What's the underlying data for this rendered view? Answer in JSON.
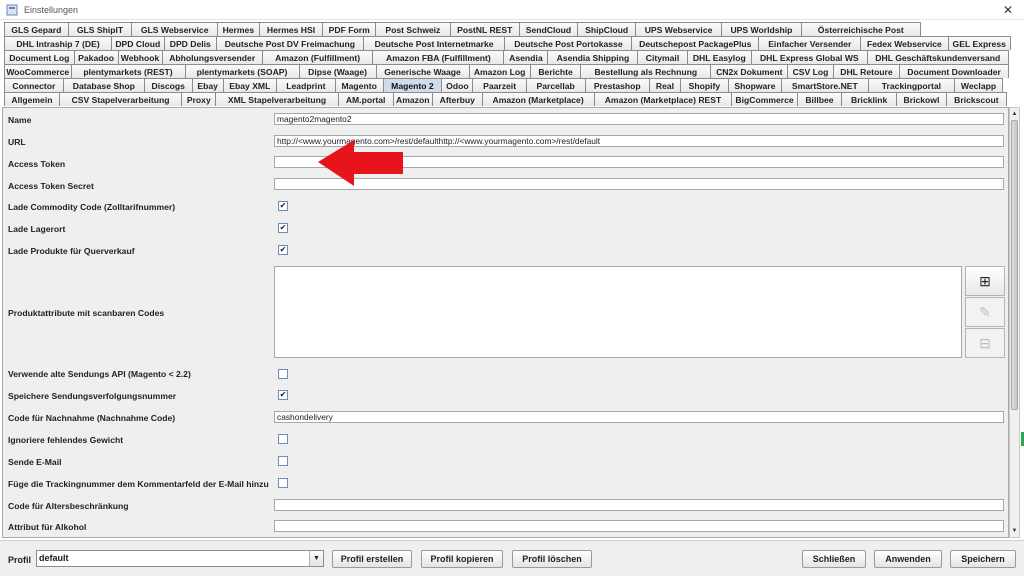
{
  "window": {
    "title": "Einstellungen",
    "close_glyph": "✕"
  },
  "tabs": {
    "row1": [
      "GLS Gepard",
      "GLS ShipIT",
      "GLS Webservice",
      "Hermes",
      "Hermes HSI",
      "PDF Form",
      "Post Schweiz",
      "PostNL REST",
      "SendCloud",
      "ShipCloud",
      "UPS Webservice",
      "UPS Worldship",
      "Österreichische Post"
    ],
    "row2": [
      "DHL Intraship 7 (DE)",
      "DPD Cloud",
      "DPD Delis",
      "Deutsche Post DV Freimachung",
      "Deutsche Post Internetmarke",
      "Deutsche Post Portokasse",
      "Deutschepost PackagePlus",
      "Einfacher Versender",
      "Fedex Webservice",
      "GEL Express"
    ],
    "row3": [
      "Document Log",
      "Pakadoo",
      "Webhook",
      "Abholungsversender",
      "Amazon (Fulfillment)",
      "Amazon FBA (Fulfillment)",
      "Asendia",
      "Asendia Shipping",
      "Citymail",
      "DHL Easylog",
      "DHL Express Global WS",
      "DHL Geschäftskundenversand"
    ],
    "row4": [
      "WooCommerce",
      "plentymarkets (REST)",
      "plentymarkets (SOAP)",
      "Dipse (Waage)",
      "Generische Waage",
      "Amazon Log",
      "Berichte",
      "Bestellung als Rechnung",
      "CN2x Dokument",
      "CSV Log",
      "DHL Retoure",
      "Document Downloader"
    ],
    "row5": [
      "Connector",
      "Database Shop",
      "Discogs",
      "Ebay",
      "Ebay XML",
      "Leadprint",
      "Magento",
      "Magento 2",
      "Odoo",
      "Paarzeit",
      "Parcellab",
      "Prestashop",
      "Real",
      "Shopify",
      "Shopware",
      "SmartStore.NET",
      "Trackingportal",
      "Weclapp"
    ],
    "row6": [
      "Allgemein",
      "CSV Stapelverarbeitung",
      "Proxy",
      "XML Stapelverarbeitung",
      "AM.portal",
      "Amazon",
      "Afterbuy",
      "Amazon (Marketplace)",
      "Amazon (Marketplace) REST",
      "BigCommerce",
      "Billbee",
      "Bricklink",
      "Brickowl",
      "Brickscout"
    ],
    "active": "Magento 2"
  },
  "form": {
    "name_label": "Name",
    "name_value": "magento2magento2",
    "url_label": "URL",
    "url_value": "http://<www.yourmagento.com>/rest/defaulthttp://<www.yourmagento.com>/rest/default",
    "access_token_label": "Access Token",
    "access_token_value": "",
    "access_token_secret_label": "Access Token Secret",
    "access_token_secret_value": "",
    "commodity_code_label": "Lade Commodity Code (Zolltarifnummer)",
    "commodity_code_checked": true,
    "lagerort_label": "Lade Lagerort",
    "lagerort_checked": true,
    "querverkauf_label": "Lade Produkte für Querverkauf",
    "querverkauf_checked": true,
    "produktattribute_label": "Produktattribute mit scanbaren Codes",
    "alte_api_label": "Verwende alte Sendungs API (Magento < 2.2)",
    "alte_api_checked": false,
    "sendungsnummer_label": "Speichere Sendungsverfolgungsnummer",
    "sendungsnummer_checked": true,
    "nachnahme_label": "Code für Nachnahme (Nachnahme Code)",
    "nachnahme_value": "cashondelivery",
    "gewicht_label": "Ignoriere fehlendes Gewicht",
    "gewicht_checked": false,
    "email_label": "Sende E-Mail",
    "email_checked": false,
    "tracking_kommentar_label": "Füge die Trackingnummer dem Kommentarfeld der E-Mail hinzu",
    "tracking_kommentar_checked": false,
    "alter_label": "Code für Altersbeschränkung",
    "alter_value": "",
    "alkohol_label": "Attribut für Alkohol",
    "alkohol_value": ""
  },
  "side_buttons": {
    "add_glyph": "⊞",
    "edit_glyph": "✎",
    "remove_glyph": "⊟"
  },
  "check_glyph": "✔",
  "bottom": {
    "profile_label": "Profil",
    "profile_value": "default",
    "create_label": "Profil erstellen",
    "copy_label": "Profil kopieren",
    "delete_label": "Profil löschen",
    "close_label": "Schließen",
    "apply_label": "Anwenden",
    "save_label": "Speichern"
  },
  "colors": {
    "annotation_arrow": "#e8141b",
    "active_tab": "#cfdcec"
  },
  "icons": [
    "app-icon",
    "close-icon",
    "add-icon",
    "edit-icon",
    "remove-icon",
    "dropdown-arrow-icon",
    "annotation-arrow-icon"
  ]
}
